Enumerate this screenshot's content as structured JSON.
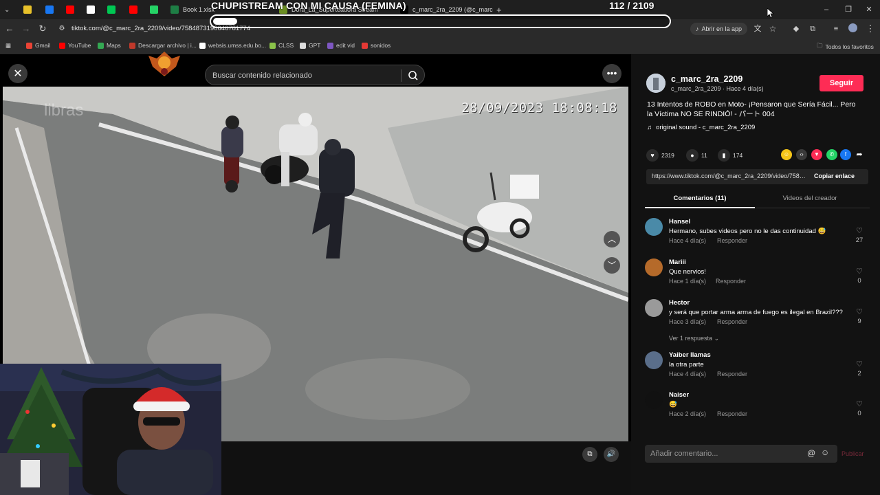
{
  "browser": {
    "tabs": [
      {
        "label": "",
        "color": "#e8c12a"
      },
      {
        "label": "",
        "color": "#1877f2"
      },
      {
        "label": "",
        "color": "#ff0000"
      },
      {
        "label": "",
        "color": "#ffffff"
      },
      {
        "label": "",
        "color": "#00c853"
      },
      {
        "label": "",
        "color": "#ff0000"
      },
      {
        "label": "",
        "color": "#25d366"
      },
      {
        "label": "Book 1.xlsx",
        "color": "#1e7e45"
      },
      {
        "label": "Dora_La_Superteadora Stream",
        "color": "#6b8e23"
      },
      {
        "label": "c_marc_2ra_2209 (@c_marc",
        "color": "#000000"
      }
    ],
    "url": "tiktok.com/@c_marc_2ra_2209/video/7584873190646781774",
    "open_in_app": "Abrir en la app",
    "bookmarks": [
      {
        "label": "Gmail",
        "color": "#ea4335"
      },
      {
        "label": "YouTube",
        "color": "#ff0000"
      },
      {
        "label": "Maps",
        "color": "#34a853"
      },
      {
        "label": "Descargar archivo | i...",
        "color": "#c0392b"
      },
      {
        "label": "websis.umss.edu.bo...",
        "color": "#ffffff"
      },
      {
        "label": "CLSS",
        "color": "#8bc34a"
      },
      {
        "label": "GPT",
        "color": "#dddddd"
      },
      {
        "label": "edit vid",
        "color": "#7e57c2"
      },
      {
        "label": "sonidos",
        "color": "#e53935"
      }
    ],
    "all_bookmarks": "Todos los favoritos"
  },
  "stream": {
    "title": "CHUPISTREAM CON MI CAUSA (FEMINA)",
    "counter": "112  / 2109",
    "progress_fraction": 0.053
  },
  "video": {
    "search_placeholder": "Buscar contenido relacionado",
    "timestamp": "28/09/2023 18:08:18"
  },
  "creator": {
    "name": "c_marc_2ra_2209",
    "subline": "c_marc_2ra_2209 · Hace 4 día(s)",
    "follow_label": "Seguir",
    "description": "13 Intentos de ROBO en Moto- ¡Pensaron que Sería Fácil... Pero la Víctima NO SE RINDIÓ! - パート 004",
    "sound": "original sound - c_marc_2ra_2209"
  },
  "stats": {
    "likes": "2319",
    "comments": "11",
    "saves": "174"
  },
  "share_colors": [
    "#f5c518",
    "#3a3a3a",
    "#fe2c55",
    "#25d366",
    "#1877f2"
  ],
  "link": {
    "url": "https://www.tiktok.com/@c_marc_2ra_2209/video/7584873190646781774",
    "copy_label": "Copiar enlace"
  },
  "panel_tabs": {
    "comments": "Comentarios (11)",
    "creator_videos": "Videos del creador"
  },
  "comments": [
    {
      "user": "Hansel",
      "text": "Hermano, subes videos pero no le das continuidad 😅",
      "time": "Hace 4 día(s)",
      "reply": "Responder",
      "likes": "27",
      "avatar": "#4a8aa8"
    },
    {
      "user": "Mariii",
      "text": "Que nervios!",
      "time": "Hace 1 día(s)",
      "reply": "Responder",
      "likes": "0",
      "avatar": "#b56a2a"
    },
    {
      "user": "Hector",
      "text": "y será que portar arma arma de fuego es ilegal en Brazil???",
      "time": "Hace 3 día(s)",
      "reply": "Responder",
      "likes": "9",
      "avatar": "#9a9a9a"
    },
    {
      "user": "Yaiber llamas",
      "text": "la otra parte",
      "time": "Hace 4 día(s)",
      "reply": "Responder",
      "likes": "2",
      "avatar": "#5a6e8a"
    },
    {
      "user": "Naiser",
      "text": "😅",
      "time": "Hace 2 día(s)",
      "reply": "Responder",
      "likes": "0",
      "avatar": "#111111"
    }
  ],
  "see_replies": "Ver 1 respuesta",
  "comment_box": {
    "placeholder": "Añadir comentario...",
    "publish": "Publicar"
  }
}
